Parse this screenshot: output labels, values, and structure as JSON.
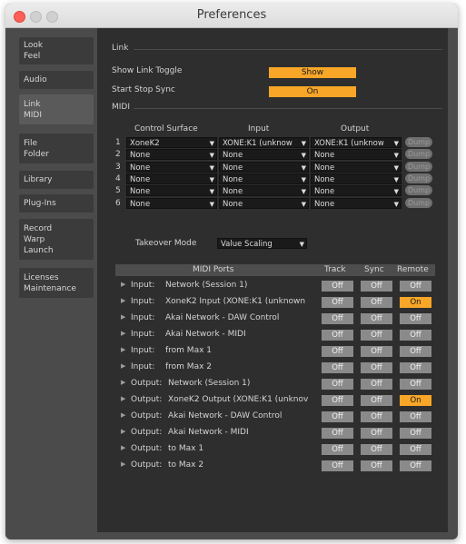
{
  "window": {
    "title": "Preferences"
  },
  "sidebar": {
    "items": [
      {
        "line1": "Look",
        "line2": "Feel"
      },
      {
        "line1": "Audio",
        "line2": ""
      },
      {
        "line1": "Link",
        "line2": "MIDI"
      },
      {
        "line1": "File",
        "line2": "Folder"
      },
      {
        "line1": "Library",
        "line2": ""
      },
      {
        "line1": "Plug-Ins",
        "line2": ""
      },
      {
        "line1": "Record",
        "line2": "Warp",
        "line3": "Launch"
      },
      {
        "line1": "Licenses",
        "line2": "Maintenance"
      }
    ]
  },
  "link": {
    "section_label": "Link",
    "show_link_toggle_label": "Show Link Toggle",
    "show_link_toggle_value": "Show",
    "start_stop_sync_label": "Start Stop Sync",
    "start_stop_sync_value": "On"
  },
  "midi": {
    "section_label": "MIDI",
    "headers": {
      "control_surface": "Control Surface",
      "input": "Input",
      "output": "Output"
    },
    "rows": [
      {
        "num": "1",
        "surface": "XoneK2",
        "input": "XONE:K1 (unknow",
        "output": "XONE:K1 (unknow",
        "dump": "Dump"
      },
      {
        "num": "2",
        "surface": "None",
        "input": "None",
        "output": "None",
        "dump": "Dump"
      },
      {
        "num": "3",
        "surface": "None",
        "input": "None",
        "output": "None",
        "dump": "Dump"
      },
      {
        "num": "4",
        "surface": "None",
        "input": "None",
        "output": "None",
        "dump": "Dump"
      },
      {
        "num": "5",
        "surface": "None",
        "input": "None",
        "output": "None",
        "dump": "Dump"
      },
      {
        "num": "6",
        "surface": "None",
        "input": "None",
        "output": "None",
        "dump": "Dump"
      }
    ],
    "takeover_label": "Takeover Mode",
    "takeover_value": "Value Scaling"
  },
  "ports": {
    "headers": {
      "ports": "MIDI Ports",
      "track": "Track",
      "sync": "Sync",
      "remote": "Remote"
    },
    "rows": [
      {
        "kind": "Input:",
        "name": "Network (Session 1)",
        "track": "Off",
        "sync": "Off",
        "remote": "Off"
      },
      {
        "kind": "Input:",
        "name": "XoneK2 Input (XONE:K1 (unknown",
        "track": "Off",
        "sync": "Off",
        "remote": "On"
      },
      {
        "kind": "Input:",
        "name": "Akai Network - DAW Control",
        "track": "Off",
        "sync": "Off",
        "remote": "Off"
      },
      {
        "kind": "Input:",
        "name": "Akai Network - MIDI",
        "track": "Off",
        "sync": "Off",
        "remote": "Off"
      },
      {
        "kind": "Input:",
        "name": "from Max 1",
        "track": "Off",
        "sync": "Off",
        "remote": "Off"
      },
      {
        "kind": "Input:",
        "name": "from Max 2",
        "track": "Off",
        "sync": "Off",
        "remote": "Off"
      },
      {
        "kind": "Output:",
        "name": "Network (Session 1)",
        "track": "Off",
        "sync": "Off",
        "remote": "Off"
      },
      {
        "kind": "Output:",
        "name": "XoneK2 Output (XONE:K1 (unknov",
        "track": "Off",
        "sync": "Off",
        "remote": "On"
      },
      {
        "kind": "Output:",
        "name": "Akai Network - DAW Control",
        "track": "Off",
        "sync": "Off",
        "remote": "Off"
      },
      {
        "kind": "Output:",
        "name": "Akai Network - MIDI",
        "track": "Off",
        "sync": "Off",
        "remote": "Off"
      },
      {
        "kind": "Output:",
        "name": "to Max 1",
        "track": "Off",
        "sync": "Off",
        "remote": "Off"
      },
      {
        "kind": "Output:",
        "name": "to Max 2",
        "track": "Off",
        "sync": "Off",
        "remote": "Off"
      }
    ]
  },
  "colors": {
    "accent": "#f7a628",
    "panel": "#2e2e2e",
    "sidebar": "#4b4b4b"
  }
}
